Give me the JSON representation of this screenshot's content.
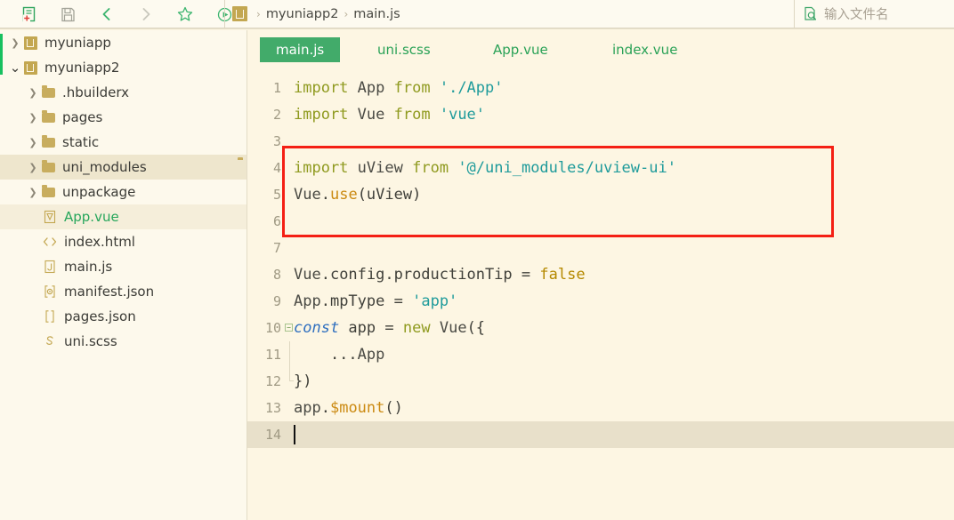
{
  "toolbar": {
    "buttons": [
      {
        "name": "new-file-icon",
        "title": "新建"
      },
      {
        "name": "save-icon",
        "title": "保存"
      },
      {
        "name": "back-chevron-icon",
        "title": "后退"
      },
      {
        "name": "forward-chevron-icon",
        "title": "前进"
      },
      {
        "name": "star-icon",
        "title": "收藏"
      },
      {
        "name": "run-icon",
        "title": "运行"
      }
    ],
    "breadcrumb": {
      "project_icon": "U",
      "separator": "›",
      "items": [
        "myuniapp2",
        "main.js"
      ]
    },
    "search": {
      "icon": "document-search-icon",
      "placeholder": "输入文件名"
    }
  },
  "sidebar": {
    "items": [
      {
        "label": "myuniapp",
        "indent": 0,
        "arrow": "collapsed",
        "icon": "uniapp-project-icon",
        "state": "normal"
      },
      {
        "label": "myuniapp2",
        "indent": 0,
        "arrow": "expanded",
        "icon": "uniapp-project-icon",
        "state": "normal"
      },
      {
        "label": ".hbuilderx",
        "indent": 1,
        "arrow": "collapsed",
        "icon": "folder-icon",
        "state": "normal"
      },
      {
        "label": "pages",
        "indent": 1,
        "arrow": "collapsed",
        "icon": "folder-icon",
        "state": "normal"
      },
      {
        "label": "static",
        "indent": 1,
        "arrow": "collapsed",
        "icon": "folder-icon",
        "state": "normal"
      },
      {
        "label": "uni_modules",
        "indent": 1,
        "arrow": "collapsed",
        "icon": "folder-icon",
        "state": "hover",
        "trailing_icon": "folder-icon"
      },
      {
        "label": "unpackage",
        "indent": 1,
        "arrow": "collapsed",
        "icon": "folder-icon",
        "state": "normal"
      },
      {
        "label": "App.vue",
        "indent": 1,
        "arrow": "none",
        "icon": "vue-file-icon",
        "state": "selected",
        "green": true
      },
      {
        "label": "index.html",
        "indent": 1,
        "arrow": "none",
        "icon": "html-file-icon",
        "state": "normal"
      },
      {
        "label": "main.js",
        "indent": 1,
        "arrow": "none",
        "icon": "js-file-icon",
        "state": "normal"
      },
      {
        "label": "manifest.json",
        "indent": 1,
        "arrow": "none",
        "icon": "manifest-file-icon",
        "state": "normal"
      },
      {
        "label": "pages.json",
        "indent": 1,
        "arrow": "none",
        "icon": "json-file-icon",
        "state": "normal"
      },
      {
        "label": "uni.scss",
        "indent": 1,
        "arrow": "none",
        "icon": "scss-file-icon",
        "state": "normal"
      }
    ]
  },
  "editor": {
    "tabs": [
      {
        "label": "main.js",
        "active": true
      },
      {
        "label": "uni.scss",
        "active": false
      },
      {
        "label": "App.vue",
        "active": false
      },
      {
        "label": "index.vue",
        "active": false
      }
    ],
    "current_line": 14,
    "lines": [
      {
        "n": "1",
        "tokens": [
          {
            "t": "import",
            "c": "kw"
          },
          {
            "t": " ",
            "c": "pl"
          },
          {
            "t": "App",
            "c": "id"
          },
          {
            "t": " ",
            "c": "pl"
          },
          {
            "t": "from",
            "c": "kw"
          },
          {
            "t": " ",
            "c": "pl"
          },
          {
            "t": "'./App'",
            "c": "str"
          }
        ]
      },
      {
        "n": "2",
        "tokens": [
          {
            "t": "import",
            "c": "kw"
          },
          {
            "t": " ",
            "c": "pl"
          },
          {
            "t": "Vue",
            "c": "id"
          },
          {
            "t": " ",
            "c": "pl"
          },
          {
            "t": "from",
            "c": "kw"
          },
          {
            "t": " ",
            "c": "pl"
          },
          {
            "t": "'vue'",
            "c": "str"
          }
        ]
      },
      {
        "n": "3",
        "tokens": []
      },
      {
        "n": "4",
        "tokens": [
          {
            "t": "import",
            "c": "kw"
          },
          {
            "t": " ",
            "c": "pl"
          },
          {
            "t": "uView",
            "c": "id"
          },
          {
            "t": " ",
            "c": "pl"
          },
          {
            "t": "from",
            "c": "kw"
          },
          {
            "t": " ",
            "c": "pl"
          },
          {
            "t": "'@/uni_modules/uview-ui'",
            "c": "str"
          }
        ]
      },
      {
        "n": "5",
        "tokens": [
          {
            "t": "Vue",
            "c": "id"
          },
          {
            "t": ".",
            "c": "pl"
          },
          {
            "t": "use",
            "c": "fn"
          },
          {
            "t": "(uView)",
            "c": "pl"
          }
        ]
      },
      {
        "n": "6",
        "tokens": []
      },
      {
        "n": "7",
        "tokens": []
      },
      {
        "n": "8",
        "tokens": [
          {
            "t": "Vue",
            "c": "id"
          },
          {
            "t": ".config.productionTip ",
            "c": "pl"
          },
          {
            "t": "=",
            "c": "pl"
          },
          {
            "t": " ",
            "c": "pl"
          },
          {
            "t": "false",
            "c": "lit"
          }
        ]
      },
      {
        "n": "9",
        "tokens": [
          {
            "t": "App",
            "c": "id"
          },
          {
            "t": ".mpType ",
            "c": "pl"
          },
          {
            "t": "=",
            "c": "pl"
          },
          {
            "t": " ",
            "c": "pl"
          },
          {
            "t": "'app'",
            "c": "str"
          }
        ]
      },
      {
        "n": "10",
        "tokens": [
          {
            "t": "const",
            "c": "co"
          },
          {
            "t": " app ",
            "c": "pl"
          },
          {
            "t": "=",
            "c": "pl"
          },
          {
            "t": " ",
            "c": "pl"
          },
          {
            "t": "new",
            "c": "kw"
          },
          {
            "t": " ",
            "c": "pl"
          },
          {
            "t": "Vue",
            "c": "id"
          },
          {
            "t": "({",
            "c": "pl"
          }
        ],
        "fold": true
      },
      {
        "n": "11",
        "tokens": [
          {
            "t": "    ...",
            "c": "pl"
          },
          {
            "t": "App",
            "c": "id"
          }
        ],
        "guide": true
      },
      {
        "n": "12",
        "tokens": [
          {
            "t": "})",
            "c": "pl"
          }
        ],
        "guide_end": true
      },
      {
        "n": "13",
        "tokens": [
          {
            "t": "app",
            "c": "id"
          },
          {
            "t": ".",
            "c": "pl"
          },
          {
            "t": "$mount",
            "c": "fn"
          },
          {
            "t": "()",
            "c": "pl"
          }
        ]
      },
      {
        "n": "14",
        "tokens": [],
        "current": true,
        "caret": true
      }
    ]
  },
  "annotation": {
    "type": "red-rectangle-highlight",
    "color": "#f41f14",
    "covers_lines": [
      "4",
      "5",
      "6"
    ]
  }
}
